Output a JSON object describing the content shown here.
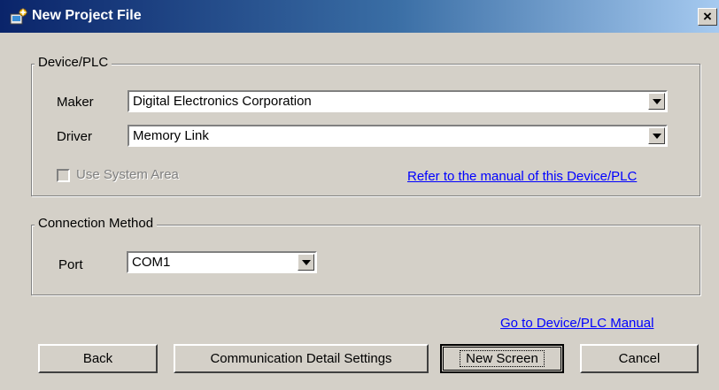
{
  "window": {
    "title": "New Project File",
    "close_glyph": "×"
  },
  "device_group": {
    "legend": "Device/PLC",
    "maker_label": "Maker",
    "maker_value": "Digital Electronics Corporation",
    "driver_label": "Driver",
    "driver_value": "Memory Link",
    "use_system_area_label": "Use System Area",
    "use_system_area_checked": false,
    "manual_link": "Refer to the manual of this Device/PLC"
  },
  "connection_group": {
    "legend": "Connection Method",
    "port_label": "Port",
    "port_value": "COM1"
  },
  "manual_link": "Go to Device/PLC Manual",
  "buttons": {
    "back": "Back",
    "comm_settings": "Communication Detail Settings",
    "new_screen": "New Screen",
    "cancel": "Cancel"
  },
  "colors": {
    "title_start": "#0a246a",
    "title_end": "#a6caf0",
    "link": "#0000ff",
    "face": "#d4d0c8"
  }
}
